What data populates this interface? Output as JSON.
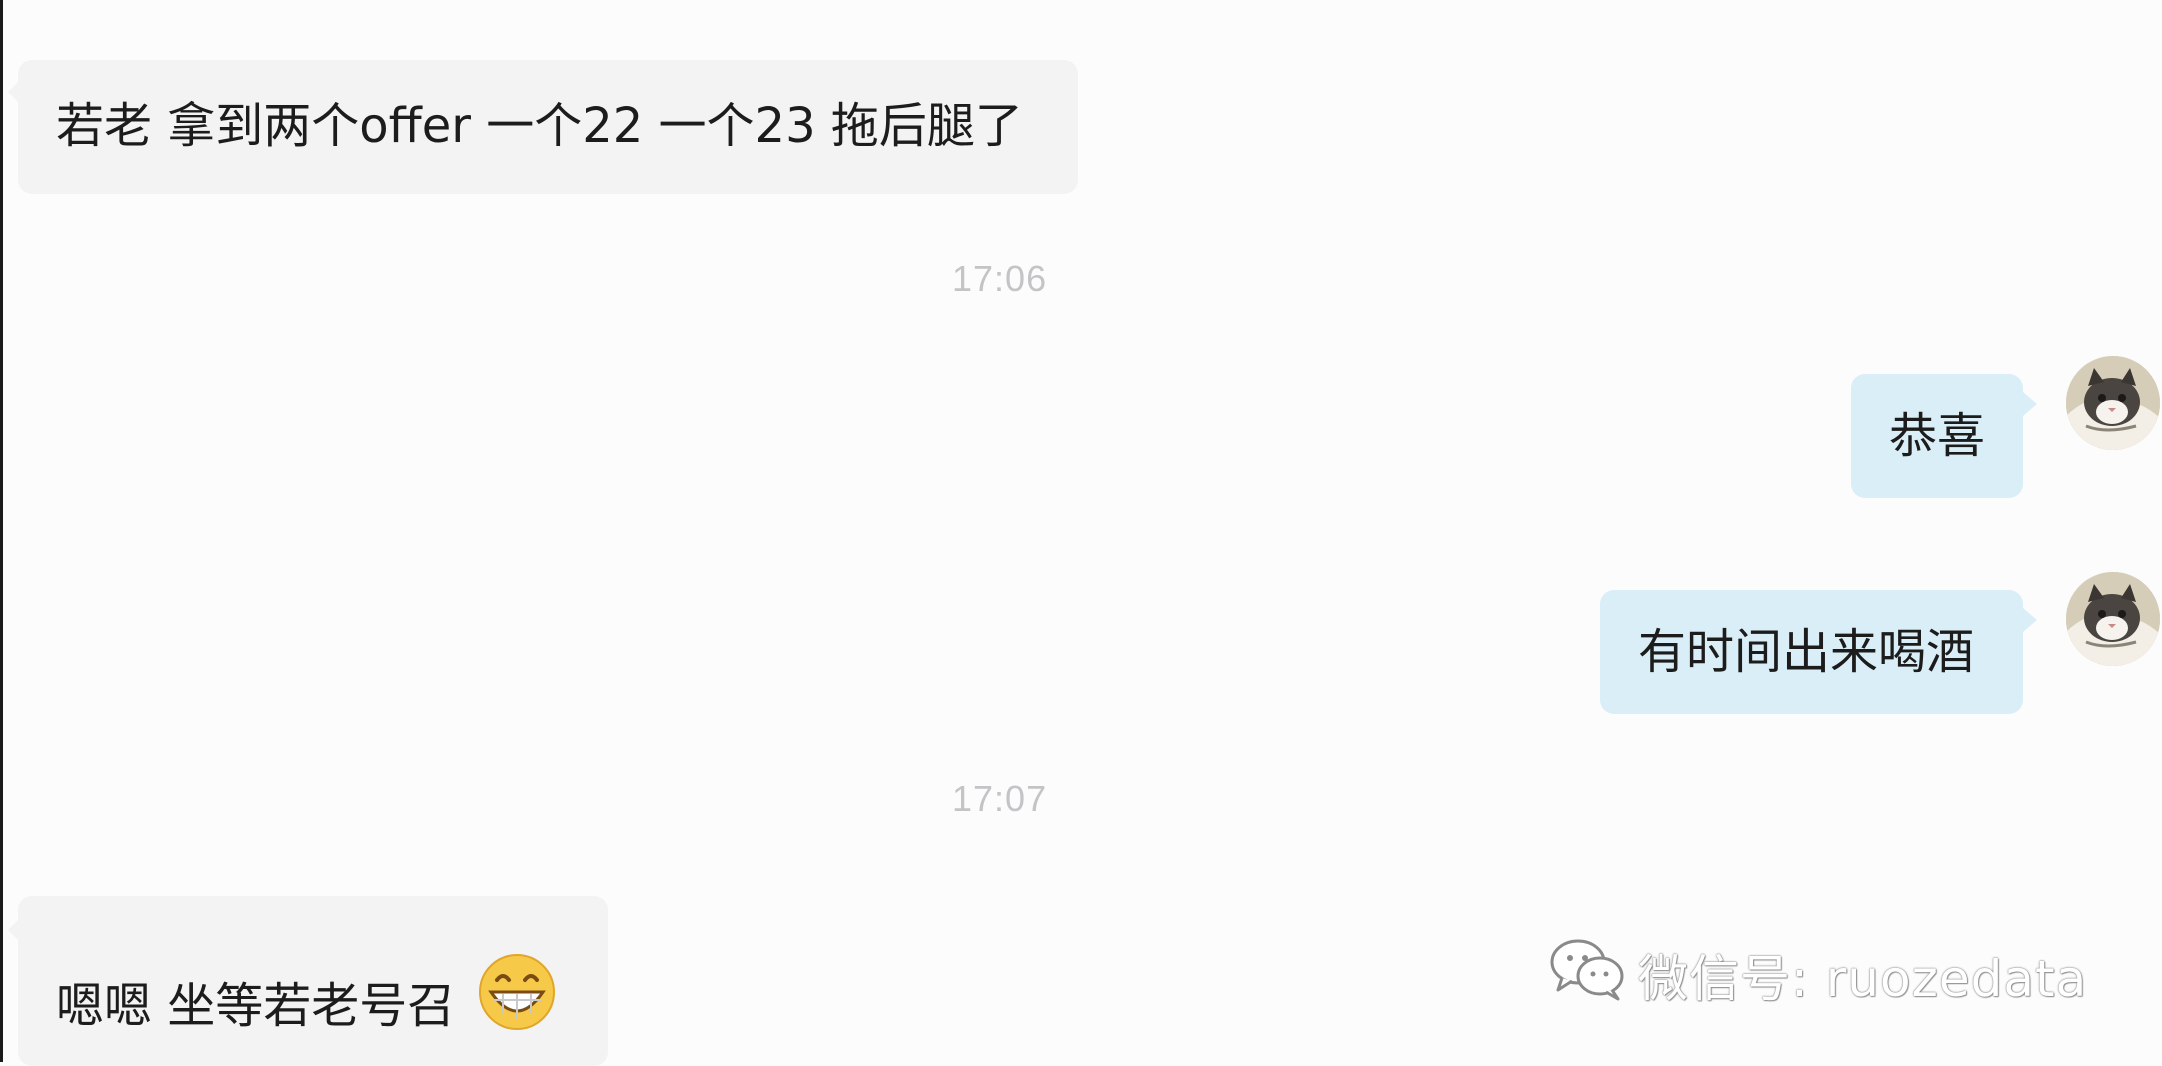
{
  "messages": [
    {
      "side": "left",
      "text": "若老 拿到两个offer 一个22 一个23 拖后腿了"
    },
    {
      "type": "time",
      "text": "17:06"
    },
    {
      "side": "right",
      "text": "恭喜"
    },
    {
      "side": "right",
      "text": "有时间出来喝酒"
    },
    {
      "type": "time",
      "text": "17:07"
    },
    {
      "side": "left",
      "text": "嗯嗯 坐等若老号召",
      "emoji": "grinning-face-icon"
    }
  ],
  "watermark": {
    "text": "微信号: ruozedata",
    "icon": "wechat-logo-icon"
  },
  "colors": {
    "incoming_bubble": "#f4f3f4",
    "outgoing_bubble": "#daeef8",
    "timestamp": "#c4c4c6",
    "background": "#fdfcfd"
  }
}
